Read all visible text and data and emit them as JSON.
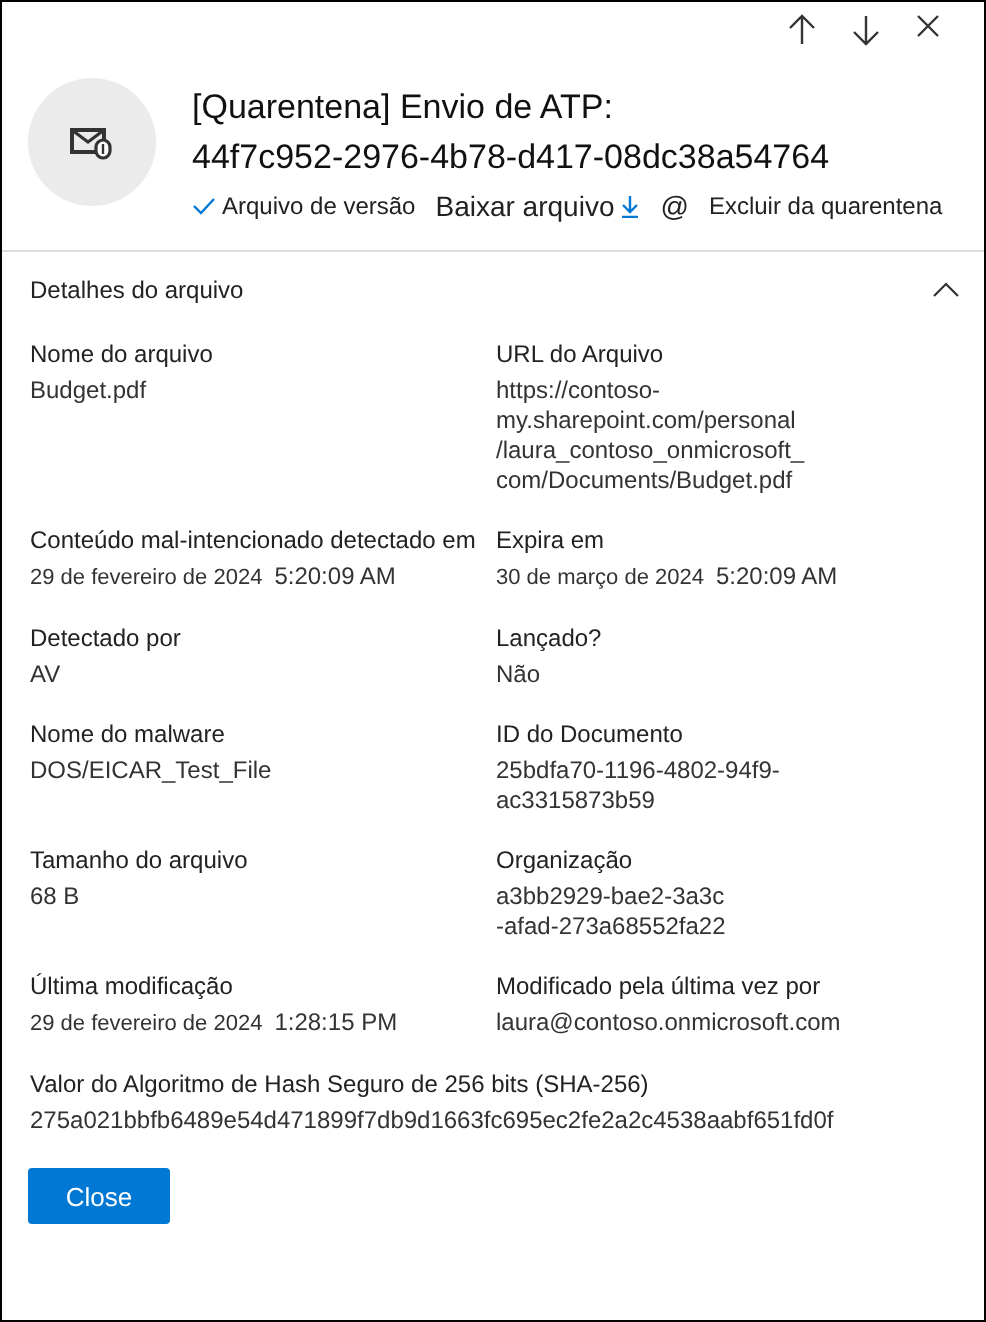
{
  "title_lines": [
    "[Quarentena] Envio de ATP:",
    "44f7c952-2976-4b78-d417-08dc38a54764"
  ],
  "actions": [
    {
      "kind": "check",
      "label": "Arquivo de versão"
    },
    {
      "kind": "download",
      "label": "Baixar arquivo",
      "trailing": "@"
    },
    {
      "kind": "plain",
      "label": "Excluir da quarentena"
    }
  ],
  "section": {
    "title": "Detalhes do arquivo",
    "expanded": true
  },
  "rows": [
    [
      {
        "label": "Nome do arquivo",
        "lines": [
          "Budget.pdf"
        ]
      },
      {
        "label": "URL do Arquivo",
        "lines": [
          "https://contoso-",
          "my.sharepoint.com/personal",
          "/laura_contoso_onmicrosoft_",
          "com/Documents/Budget.pdf"
        ]
      }
    ],
    [
      {
        "label": "Conteúdo mal-intencionado detectado em",
        "lines": [
          "29 de fevereiro de 2024"
        ],
        "time": "5:20:09 AM"
      },
      {
        "label": "Expira em",
        "lines": [
          "30 de março de 2024"
        ],
        "time": "5:20:09 AM"
      }
    ],
    [
      {
        "label": "Detectado por",
        "lines": [
          "AV"
        ]
      },
      {
        "label": "Lançado?",
        "lines": [
          "Não"
        ]
      }
    ],
    [
      {
        "label": "Nome do malware",
        "lines": [
          "DOS/EICAR_Test_File"
        ]
      },
      {
        "label": "ID do Documento",
        "lines": [
          "25bdfa70-1196-4802-94f9-",
          "ac3315873b59"
        ]
      }
    ],
    [
      {
        "label": "Tamanho do arquivo",
        "lines": [
          "68 B"
        ]
      },
      {
        "label": "Organização",
        "lines": [
          "a3bb2929-bae2-3a3c",
          "-afad-273a68552fa22"
        ]
      }
    ],
    [
      {
        "label": "Última modificação",
        "lines": [
          "29 de fevereiro de 2024"
        ],
        "time": "1:28:15 PM"
      },
      {
        "label": "Modificado pela última vez por",
        "lines": [
          "laura@contoso.onmicrosoft.com"
        ]
      }
    ],
    [
      {
        "label": "Valor do Algoritmo de Hash Seguro de 256 bits (SHA-256)",
        "lines": [
          "275a021bbfb6489e54d471899f7db9d1663fc695ec2fe2a2c4538aabf651fd0f"
        ]
      }
    ]
  ],
  "button": "Close"
}
